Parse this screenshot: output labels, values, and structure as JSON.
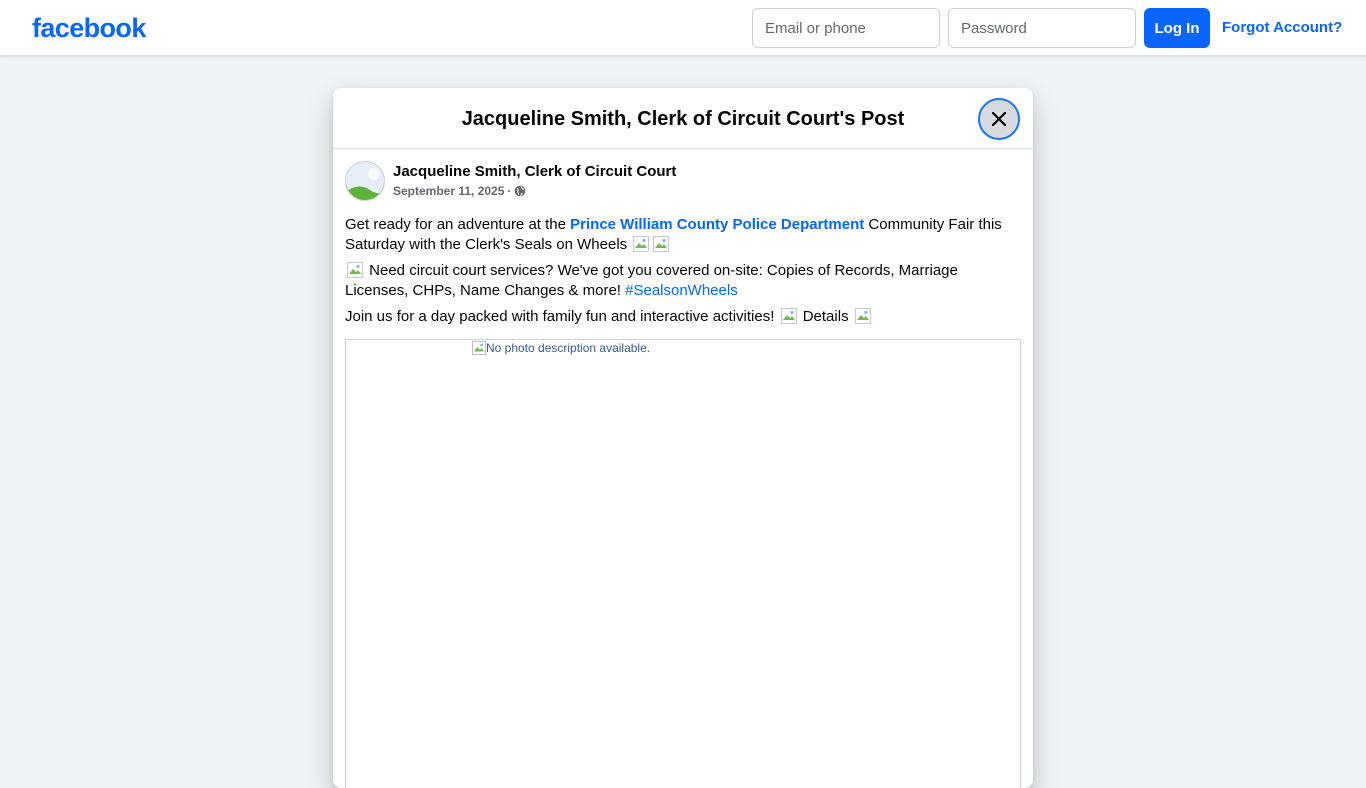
{
  "header": {
    "logo_text": "facebook",
    "email_placeholder": "Email or phone",
    "password_placeholder": "Password",
    "login_label": "Log In",
    "forgot_label": "Forgot Account?"
  },
  "dialog": {
    "title": "Jacqueline Smith, Clerk of Circuit Court's Post",
    "close_icon": "close-icon"
  },
  "post": {
    "author": "Jacqueline Smith, Clerk of Circuit Court",
    "date": "September 11, 2025",
    "separator": "·",
    "audience_icon": "globe-icon",
    "paragraph1": {
      "before_link": "Get ready for an adventure at the ",
      "link": "Prince William County Police Department",
      "after_link": " Community Fair this Saturday with the Clerk's Seals on Wheels "
    },
    "paragraph2": {
      "text": " Need circuit court services? We've got you covered on-site: Copies of Records, Marriage Licenses, CHPs, Name Changes & more! ",
      "hashtag": "#SealsonWheels"
    },
    "paragraph3": {
      "before": "Join us for a day packed with family fun and interactive activities! ",
      "middle": " Details "
    },
    "photo_alt": "No photo description available."
  },
  "colors": {
    "brand_blue": "#0866ff",
    "page_background": "#f0f2f5",
    "text_secondary": "#65676b"
  }
}
